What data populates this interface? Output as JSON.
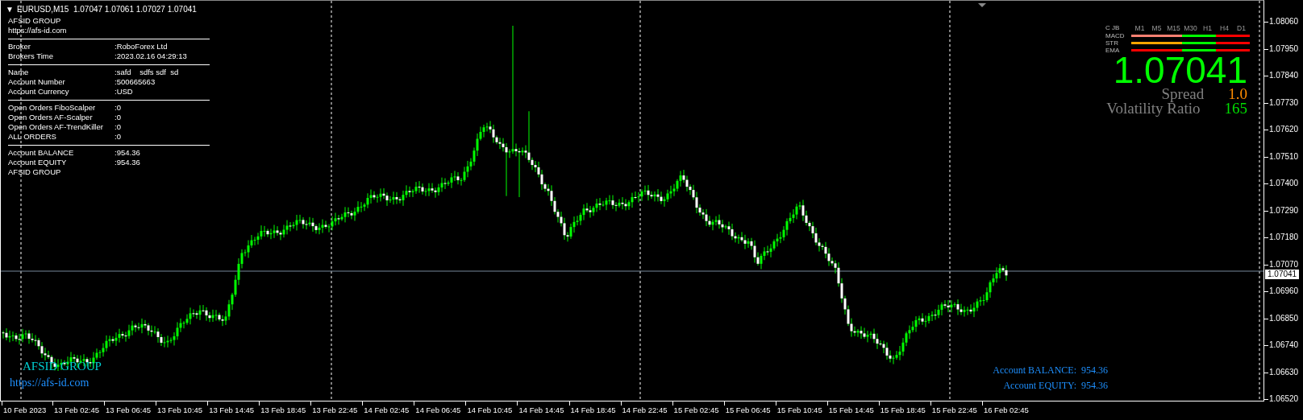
{
  "chart": {
    "menu_glyph": "▼",
    "symbol_header": "EURUSD,M15  1.07047 1.07061 1.07027 1.07041",
    "brand": "AFSID GROUP",
    "url": "https://afs-id.com",
    "info_sections": [
      {
        "rows": [
          {
            "label": "Broker",
            "value": ":RoboForex Ltd"
          },
          {
            "label": "Brokers Time",
            "value": ":2023.02.16 04:29:13"
          }
        ]
      },
      {
        "rows": [
          {
            "label": "Name",
            "value": ":safd    sdfs sdf  sd"
          },
          {
            "label": "Account Number",
            "value": ":500665663"
          },
          {
            "label": "Account Currency",
            "value": ":USD"
          }
        ]
      },
      {
        "rows": [
          {
            "label": "Open Orders FiboScalper",
            "value": ":0"
          },
          {
            "label": "Open Orders AF-Scalper",
            "value": ":0"
          },
          {
            "label": "Open Orders AF-TrendKiller",
            "value": ":0"
          },
          {
            "label": "ALL ORDERS",
            "value": ":0"
          }
        ]
      },
      {
        "rows": [
          {
            "label": "Account BALANCE",
            "value": ":954.36"
          },
          {
            "label": "Account EQUITY",
            "value": ":954.36"
          }
        ]
      }
    ],
    "info_footer": "AFSID GROUP",
    "signal_panel": {
      "title": "C JB",
      "timeframes": [
        "M1",
        "M5",
        "M15",
        "M30",
        "H1",
        "H4",
        "D1"
      ],
      "rows": [
        {
          "label": "MACD",
          "cells": [
            {
              "color": "#fa8072"
            },
            {
              "color": "#fa8072"
            },
            {
              "color": "#fa8072"
            },
            {
              "color": "#00ff00"
            },
            {
              "color": "#00ff00"
            },
            {
              "color": "#ff0000"
            },
            {
              "color": "#ff0000"
            }
          ]
        },
        {
          "label": "STR",
          "cells": [
            {
              "color": "#ffa500"
            },
            {
              "color": "#ffa500"
            },
            {
              "color": "#ffa500"
            },
            {
              "color": "#00ff00"
            },
            {
              "color": "#00ff00"
            },
            {
              "color": "#ff0000"
            },
            {
              "color": "#ff0000"
            }
          ]
        },
        {
          "label": "EMA",
          "cells": [
            {
              "color": "#ff0000"
            },
            {
              "color": "#ff0000"
            },
            {
              "color": "#ff0000"
            },
            {
              "color": "#00ff00"
            },
            {
              "color": "#00ff00"
            },
            {
              "color": "#ff0000"
            },
            {
              "color": "#ff0000"
            }
          ]
        }
      ]
    },
    "big_price": "1.07041",
    "spread": {
      "label": "Spread",
      "value": "1.0"
    },
    "volatility": {
      "label": "Volatility Ratio",
      "value": "165"
    },
    "bottom_brand": "AFSID GROUP",
    "bottom_url": "https://afs-id.com",
    "account_summary": [
      {
        "label": "Account BALANCE:",
        "value": "954.36"
      },
      {
        "label": "Account EQUITY:",
        "value": "954.36"
      }
    ],
    "price_ticks": [
      "1.08060",
      "1.07950",
      "1.07840",
      "1.07730",
      "1.07620",
      "1.07510",
      "1.07400",
      "1.07290",
      "1.07180",
      "1.07070",
      "1.06960",
      "1.06850",
      "1.06740",
      "1.06630",
      "1.06520"
    ],
    "current_price": "1.07041",
    "time_labels": [
      "10 Feb 2023",
      "13 Feb 02:45",
      "13 Feb 06:45",
      "13 Feb 10:45",
      "13 Feb 14:45",
      "13 Feb 18:45",
      "13 Feb 22:45",
      "14 Feb 02:45",
      "14 Feb 06:45",
      "14 Feb 10:45",
      "14 Feb 14:45",
      "14 Feb 18:45",
      "14 Feb 22:45",
      "15 Feb 02:45",
      "15 Feb 06:45",
      "15 Feb 10:45",
      "15 Feb 14:45",
      "15 Feb 18:45",
      "15 Feb 22:45",
      "16 Feb 02:45"
    ]
  }
}
